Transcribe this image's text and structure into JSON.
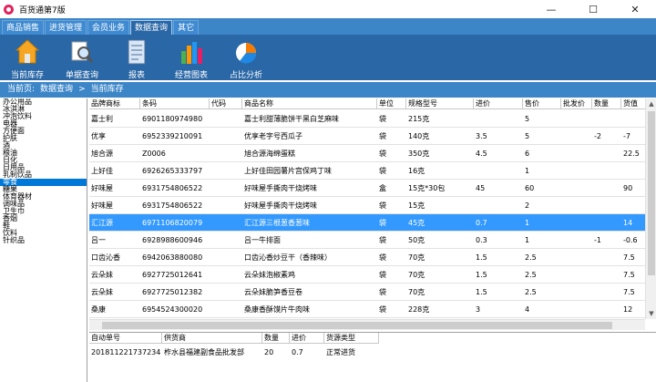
{
  "window": {
    "title": "百货通第7版",
    "minimize": "—",
    "maximize": "☐",
    "close": "✕"
  },
  "menu": {
    "tabs": [
      "商品销售",
      "进货管理",
      "会员业务",
      "数据查询",
      "其它"
    ],
    "active": "数据查询"
  },
  "toolbar": {
    "items": [
      {
        "label": "当前库存",
        "icon": "home-icon"
      },
      {
        "label": "单据查询",
        "icon": "magnifier-icon"
      },
      {
        "label": "报表",
        "icon": "report-icon"
      },
      {
        "label": "经营图表",
        "icon": "bar-chart-icon"
      },
      {
        "label": "占比分析",
        "icon": "pie-chart-icon"
      }
    ]
  },
  "breadcrumb": {
    "prefix": "当前页:",
    "section": "数据查询",
    "separator": ">",
    "page": "当前库存"
  },
  "categories": {
    "items": [
      "办公用品",
      "冰淇淋",
      "冲泡饮料",
      "电器",
      "方便面",
      "护肤",
      "酒",
      "粮油",
      "日化",
      "日用品",
      "乳制饮品",
      "零食",
      "糖果",
      "体育器材",
      "调味品",
      "卫生巾",
      "香烟",
      "鞋",
      "饮料",
      "针织品"
    ],
    "selected": "零食"
  },
  "grid": {
    "columns": [
      "品牌商标",
      "条码",
      "代码",
      "商品名称",
      "单位",
      "规格型号",
      "进价",
      "售价",
      "批发价",
      "数量",
      "货值"
    ],
    "rows": [
      {
        "brand": "嘉士利",
        "barcode": "6901180974980",
        "code": "",
        "name": "嘉士利甜薄脆饼干黑白芝麻味",
        "unit": "袋",
        "spec": "215克",
        "cost": "",
        "price": "5",
        "wholesale": "",
        "qty": "",
        "value": ""
      },
      {
        "brand": "优享",
        "barcode": "6952339210091",
        "code": "",
        "name": "优享老字号西瓜子",
        "unit": "袋",
        "spec": "140克",
        "cost": "3.5",
        "price": "5",
        "wholesale": "",
        "qty": "-2",
        "value": "-7"
      },
      {
        "brand": "旭合源",
        "barcode": "Z0006",
        "code": "",
        "name": "旭合源海绵蛋糕",
        "unit": "袋",
        "spec": "350克",
        "cost": "4.5",
        "price": "6",
        "wholesale": "",
        "qty": "",
        "value": "22.5"
      },
      {
        "brand": "上好佳",
        "barcode": "6926265333797",
        "code": "",
        "name": "上好佳田园薯片宫保鸡丁味",
        "unit": "袋",
        "spec": "16克",
        "cost": "",
        "price": "1",
        "wholesale": "",
        "qty": "",
        "value": ""
      },
      {
        "brand": "好味屋",
        "barcode": "6931754806522",
        "code": "",
        "name": "好味屋手撕肉干烧烤味",
        "unit": "盒",
        "spec": "15克*30包",
        "cost": "45",
        "price": "60",
        "wholesale": "",
        "qty": "",
        "value": "90"
      },
      {
        "brand": "好味屋",
        "barcode": "6931754806522",
        "code": "",
        "name": "好味屋手撕肉干烧烤味",
        "unit": "袋",
        "spec": "15克",
        "cost": "",
        "price": "2",
        "wholesale": "",
        "qty": "",
        "value": ""
      },
      {
        "brand": "汇江源",
        "barcode": "6971106820079",
        "code": "",
        "name": "汇江源三根葱香葱味",
        "unit": "袋",
        "spec": "45克",
        "cost": "0.7",
        "price": "1",
        "wholesale": "",
        "qty": "",
        "value": "14"
      },
      {
        "brand": "吕一",
        "barcode": "6928988600946",
        "code": "",
        "name": "吕一牛排面",
        "unit": "袋",
        "spec": "50克",
        "cost": "0.3",
        "price": "1",
        "wholesale": "",
        "qty": "-1",
        "value": "-0.6"
      },
      {
        "brand": "口齿沁香",
        "barcode": "6942063880080",
        "code": "",
        "name": "口齿沁香炒豆干（香辣味）",
        "unit": "袋",
        "spec": "70克",
        "cost": "1.5",
        "price": "2.5",
        "wholesale": "",
        "qty": "",
        "value": "7.5"
      },
      {
        "brand": "云朵妹",
        "barcode": "6927725012641",
        "code": "",
        "name": "云朵妹泡椒素鸡",
        "unit": "袋",
        "spec": "70克",
        "cost": "1.5",
        "price": "2.5",
        "wholesale": "",
        "qty": "",
        "value": "7.5"
      },
      {
        "brand": "云朵妹",
        "barcode": "6927725012382",
        "code": "",
        "name": "云朵妹脆笋香豆卷",
        "unit": "袋",
        "spec": "70克",
        "cost": "1.5",
        "price": "2.5",
        "wholesale": "",
        "qty": "",
        "value": "7.5"
      },
      {
        "brand": "桑康",
        "barcode": "6954524300020",
        "code": "",
        "name": "桑康香酥馍片牛肉味",
        "unit": "袋",
        "spec": "228克",
        "cost": "3",
        "price": "4",
        "wholesale": "",
        "qty": "",
        "value": "12"
      }
    ],
    "selected_row": 6
  },
  "detail": {
    "columns": [
      "自动单号",
      "供货商",
      "数量",
      "进价",
      "货源类型"
    ],
    "rows": [
      {
        "order": "201811221737234",
        "supplier": "柞水县福建副食品批发部",
        "qty": "20",
        "cost": "0.7",
        "source": "正常进货"
      }
    ]
  },
  "colors": {
    "menubar": "#3c86c8",
    "toolbar": "#2a67a6",
    "selection": "#3399ff"
  }
}
